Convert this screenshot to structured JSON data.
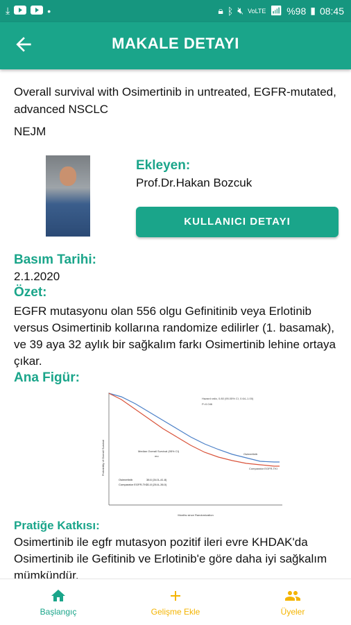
{
  "status_bar": {
    "battery": "%98",
    "time": "08:45",
    "network": "VoLTE"
  },
  "header": {
    "title": "MAKALE DETAYI",
    "back_icon": "arrow-left-icon"
  },
  "article": {
    "title": "Overall survival with Osimertinib in untreated, EGFR-mutated, advanced NSCLC",
    "source": "NEJM",
    "author_label": "Ekleyen:",
    "author_name": "Prof.Dr.Hakan Bozcuk",
    "user_button": "KULLANICI DETAYI",
    "date_label": "Basım Tarihi:",
    "date": "2.1.2020",
    "summary_label": "Özet:",
    "summary": "EGFR mutasyonu olan 556 olgu Gefinitinib veya Erlotinib versus Osimertinib kollarına randomize edilirler (1. basamak), ve 39 aya 32 aylık bir sağkalım farkı Osimertinib lehine ortaya çıkar.",
    "figure_label": "Ana Figür:",
    "contribution_label": "Pratiğe Katkısı:",
    "contribution": "Osimertinib ile egfr mutasyon pozitif ileri evre KHDAK'da Osimertinib ile Gefitinib ve Erlotinib'e göre daha iyi sağkalım mümkündür."
  },
  "figure": {
    "y_axis_label": "Probability of Overall Survival",
    "x_axis_label": "Months since Randomization",
    "hazard_text": "Hazard ratio, 0.80 (95.05% CI, 0.64–1.00)",
    "p_text": "P=0.046",
    "median_title": "Median Overall Survival (95% CI)",
    "median_unit": "mo",
    "osimertinib_label": "Osimertinib",
    "osimertinib_val": "38.6 (34.5–41.8)",
    "comparator_label": "Comparator EGFR-TKI",
    "comparator_val": "31.8 (26.6–36.0)",
    "series_osimertinib": "Osimertinib",
    "series_comparator": "Comparator EGFR-TKI",
    "colors": {
      "osimertinib": "#4a7fc7",
      "comparator": "#d9533a"
    }
  },
  "bottom_nav": [
    {
      "label": "Başlangıç",
      "icon": "home-icon"
    },
    {
      "label": "Gelişme Ekle",
      "icon": "plus-icon"
    },
    {
      "label": "Üyeler",
      "icon": "group-icon"
    }
  ],
  "colors": {
    "primary": "#1aa58a",
    "accent": "#f4b400"
  }
}
